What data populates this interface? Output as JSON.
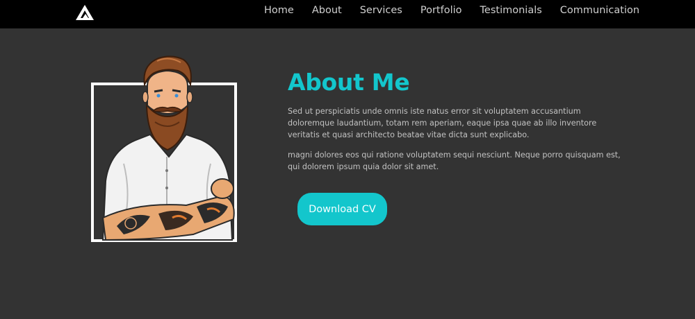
{
  "nav": {
    "logo_icon": "triangle-a-logo-icon",
    "links": [
      "Home",
      "About",
      "Services",
      "Portfolio",
      "Testimonials",
      "Communication"
    ]
  },
  "about": {
    "title": "About Me",
    "paragraph1": "Sed ut perspiciatis unde omnis iste natus error sit voluptatem accusantium doloremque laudantium, totam rem aperiam, eaque ipsa quae ab illo inventore veritatis et quasi architecto beatae vitae dicta sunt explicabo.",
    "paragraph2": "magni dolores eos qui ratione voluptatem sequi nesciunt. Neque porro quisquam est, qui dolorem ipsum quia dolor sit amet.",
    "button_label": "Download CV"
  },
  "colors": {
    "accent": "#13c6cc",
    "background": "#333333",
    "navbar": "#000000"
  }
}
